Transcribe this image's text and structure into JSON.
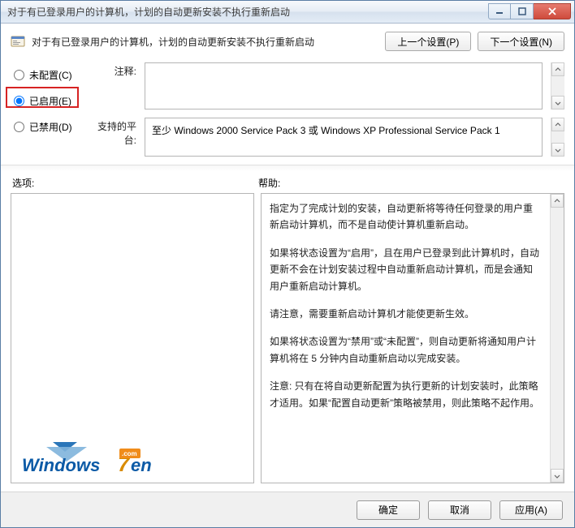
{
  "titlebar": {
    "text": "对于有已登录用户的计算机，计划的自动更新安装不执行重新启动"
  },
  "header": {
    "policy_title": "对于有已登录用户的计算机，计划的自动更新安装不执行重新启动",
    "prev_btn": "上一个设置(P)",
    "next_btn": "下一个设置(N)"
  },
  "radios": {
    "not_configured": "未配置(C)",
    "enabled": "已启用(E)",
    "disabled": "已禁用(D)"
  },
  "fields": {
    "comment_label": "注释:",
    "platform_label": "支持的平台:",
    "platform_text": "至少 Windows 2000 Service Pack 3 或 Windows XP Professional Service Pack 1"
  },
  "sections": {
    "options_label": "选项:",
    "help_label": "帮助:"
  },
  "help": {
    "p1": "指定为了完成计划的安装，自动更新将等待任何登录的用户重新启动计算机，而不是自动使计算机重新启动。",
    "p2": "如果将状态设置为“启用”，且在用户已登录到此计算机时，自动更新不会在计划安装过程中自动重新启动计算机，而是会通知用户重新启动计算机。",
    "p3": "请注意，需要重新启动计算机才能使更新生效。",
    "p4": "如果将状态设置为“禁用”或“未配置”，则自动更新将通知用户计算机将在 5 分钟内自动重新启动以完成安装。",
    "p5": "注意: 只有在将自动更新配置为执行更新的计划安装时，此策略才适用。如果“配置自动更新”策略被禁用，则此策略不起作用。"
  },
  "footer": {
    "ok": "确定",
    "cancel": "取消",
    "apply": "应用(A)"
  }
}
